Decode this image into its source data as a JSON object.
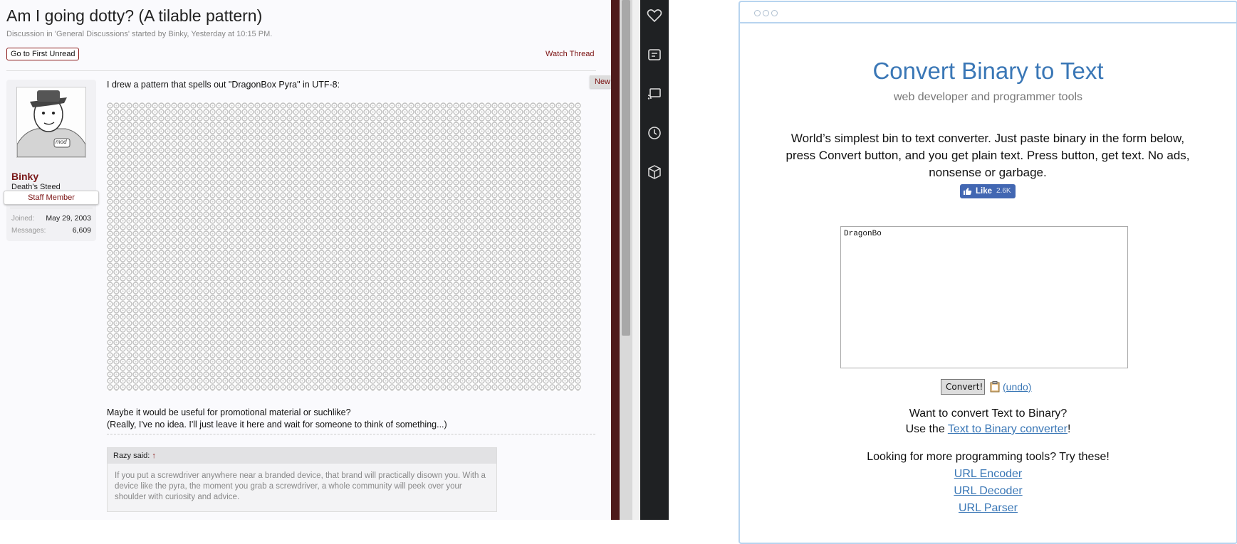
{
  "forum": {
    "thread_title": "Am I going dotty? (A tilable pattern)",
    "thread_meta": "Discussion in 'General Discussions' started by Binky, Yesterday at 10:15 PM.",
    "first_unread": "Go to First Unread",
    "watch_thread": "Watch Thread",
    "user": {
      "name": "Binky",
      "title": "Death's Steed",
      "badge": "Staff Member",
      "avatar_tag": "mod",
      "joined_label": "Joined:",
      "joined_value": "May 29, 2003",
      "messages_label": "Messages:",
      "messages_value": "6,609"
    },
    "post": {
      "new_badge": "New",
      "intro": "I drew a pattern that spells out \"DragonBox Pyra\" in UTF-8:",
      "line1": "Maybe it would be useful for promotional material or suchlike?",
      "line2": "(Really, I've no idea. I'll just leave it here and wait for someone to think of something...)"
    },
    "quote": {
      "author": "Razy said:",
      "arrow": "↑",
      "text": "If you put a screwdriver anywhere near a branded device, that brand will practically disown you. With a device like the pyra, the moment you grab a screwdriver, a whole community will peek over your shoulder with curiosity and advice."
    }
  },
  "sidebar_icons": [
    "heart-icon",
    "notes-icon",
    "cast-icon",
    "history-icon",
    "box-icon"
  ],
  "site": {
    "title": "Convert Binary to Text",
    "subtitle": "web developer and programmer tools",
    "description": "World’s simplest bin to text converter. Just paste binary in the form below, press Convert button, and you get plain text. Press button, get text. No ads, nonsense or garbage.",
    "fb_like": "Like",
    "fb_count": "2.6K",
    "input_value": "DragonBo",
    "convert_label": "Convert!",
    "undo_label": "(undo)",
    "want_text": "Want to convert Text to Binary?",
    "use_the": "Use the ",
    "t2b_link": "Text to Binary converter",
    "excl": "!",
    "more_tools": "Looking for more programming tools? Try these!",
    "links": [
      "URL Encoder",
      "URL Decoder",
      "URL Parser"
    ]
  },
  "colors": {
    "forum_accent": "#7a1818",
    "site_title_blue": "#3a77b6",
    "browser_border": "#b7d4ef",
    "sidebar_bg": "#1f2123",
    "fb_blue": "#4267b2"
  }
}
